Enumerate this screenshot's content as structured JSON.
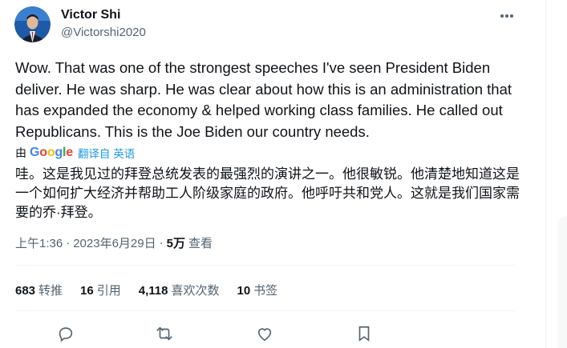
{
  "author": {
    "name": "Victor Shi",
    "handle": "@Victorshi2020"
  },
  "tweet": {
    "text": "Wow. That was one of the strongest speeches I've seen President Biden deliver. He was sharp. He was clear about how this is an administration that has expanded the economy & helped working class families. He called out Republicans. This is the Joe Biden our country needs.",
    "translation_prefix": "由",
    "translation_provider": "Google",
    "translation_link": "翻译自 英语",
    "translated_text": "哇。这是我见过的拜登总统发表的最强烈的演讲之一。他很敏锐。他清楚地知道这是一个如何扩大经济并帮助工人阶级家庭的政府。他呼吁共和党人。这就是我们国家需要的乔·拜登。"
  },
  "meta": {
    "time": "上午1:36",
    "sep1": "·",
    "date": "2023年6月29日",
    "sep2": "·",
    "views_count": "5万",
    "views_label": "查看"
  },
  "stats": [
    {
      "count": "683",
      "label": "转推"
    },
    {
      "count": "16",
      "label": "引用"
    },
    {
      "count": "4,118",
      "label": "喜欢次数"
    },
    {
      "count": "10",
      "label": "书签"
    }
  ],
  "icons": {
    "more": "more-icon",
    "reply": "reply-icon",
    "retweet": "retweet-icon",
    "like": "like-icon",
    "bookmark": "bookmark-icon"
  },
  "colors": {
    "text": "#0f1419",
    "secondary": "#536471",
    "link": "#1d9bf0",
    "divider": "#eff3f4"
  }
}
